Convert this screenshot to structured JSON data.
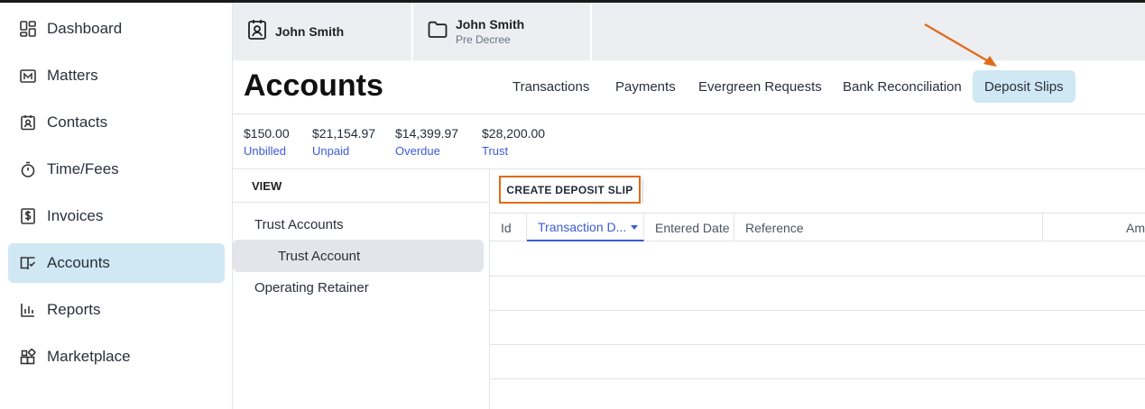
{
  "sidebar": {
    "items": [
      {
        "label": "Dashboard",
        "icon": "dashboard-icon"
      },
      {
        "label": "Matters",
        "icon": "matters-icon"
      },
      {
        "label": "Contacts",
        "icon": "contacts-icon"
      },
      {
        "label": "Time/Fees",
        "icon": "stopwatch-icon"
      },
      {
        "label": "Invoices",
        "icon": "invoice-icon"
      },
      {
        "label": "Accounts",
        "icon": "accounts-icon",
        "active": true
      },
      {
        "label": "Reports",
        "icon": "reports-icon"
      },
      {
        "label": "Marketplace",
        "icon": "marketplace-icon"
      }
    ]
  },
  "matter_tabs": [
    {
      "name": "John Smith",
      "icon": "contact-card-icon"
    },
    {
      "name": "John Smith",
      "sub": "Pre Decree",
      "icon": "folder-icon"
    }
  ],
  "page": {
    "title": "Accounts",
    "tabs": [
      "Transactions",
      "Payments",
      "Evergreen Requests",
      "Bank Reconciliation",
      "Deposit Slips"
    ],
    "active_tab": "Deposit Slips"
  },
  "summary": [
    {
      "amount": "$150.00",
      "label": "Unbilled"
    },
    {
      "amount": "$21,154.97",
      "label": "Unpaid"
    },
    {
      "amount": "$14,399.97",
      "label": "Overdue"
    },
    {
      "amount": "$28,200.00",
      "label": "Trust"
    }
  ],
  "view": {
    "heading": "VIEW",
    "items": [
      "Trust Accounts",
      "Trust Account",
      "Operating Retainer"
    ],
    "selected": "Trust Account"
  },
  "grid": {
    "create_button": "CREATE DEPOSIT SLIP",
    "columns": [
      "Id",
      "Transaction D...",
      "Entered Date",
      "Reference",
      "Am"
    ],
    "sorted_column": "Transaction D..."
  },
  "colors": {
    "accent": "#3b5bd6",
    "active_bg": "#cfe8f3",
    "highlight": "#e06a1a"
  }
}
